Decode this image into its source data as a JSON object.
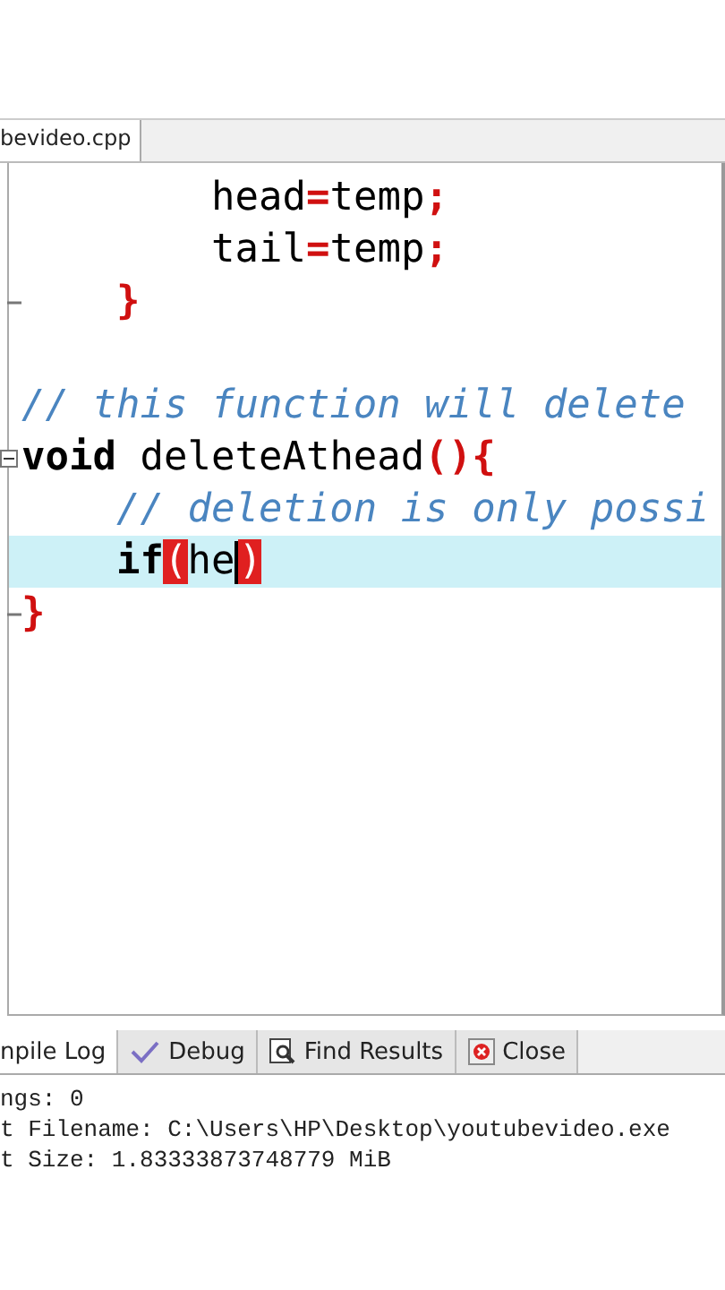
{
  "editor_tabs": [
    {
      "label": "bevideo.cpp",
      "selected": true
    }
  ],
  "code_lines": [
    {
      "kind": "plain",
      "current": false,
      "tokens": [
        {
          "kind": "text",
          "text": "        head"
        },
        {
          "kind": "op",
          "text": "="
        },
        {
          "kind": "text",
          "text": "temp"
        },
        {
          "kind": "op",
          "text": ";"
        }
      ]
    },
    {
      "kind": "plain",
      "current": false,
      "tokens": [
        {
          "kind": "text",
          "text": "        tail"
        },
        {
          "kind": "op",
          "text": "="
        },
        {
          "kind": "text",
          "text": "temp"
        },
        {
          "kind": "op",
          "text": ";"
        }
      ]
    },
    {
      "kind": "foldend",
      "current": false,
      "tokens": [
        {
          "kind": "op",
          "text": "    }"
        }
      ]
    },
    {
      "kind": "blank",
      "current": false
    },
    {
      "kind": "plain",
      "current": false,
      "tokens": [
        {
          "kind": "comment",
          "text": "// this function will delete"
        }
      ]
    },
    {
      "kind": "foldstart",
      "current": false,
      "tokens": [
        {
          "kind": "keyword",
          "text": "void"
        },
        {
          "kind": "text",
          "text": " deleteAthead"
        },
        {
          "kind": "op",
          "text": "(){"
        }
      ]
    },
    {
      "kind": "plain",
      "current": false,
      "tokens": [
        {
          "kind": "comment",
          "text": "    // deletion is only possi"
        }
      ]
    },
    {
      "kind": "plain",
      "current": true,
      "tokens": [
        {
          "kind": "keyword",
          "text": "    if"
        },
        {
          "kind": "match",
          "text": "("
        },
        {
          "kind": "text",
          "text": "he"
        },
        {
          "kind": "caret"
        },
        {
          "kind": "match",
          "text": ")"
        }
      ]
    },
    {
      "kind": "foldend",
      "current": false,
      "tokens": [
        {
          "kind": "op",
          "text": "}"
        }
      ]
    }
  ],
  "panel_tabs": [
    {
      "kind": "log",
      "label": "npile Log",
      "selected": true
    },
    {
      "kind": "debug",
      "label": "Debug",
      "selected": false
    },
    {
      "kind": "find",
      "label": "Find Results",
      "selected": false
    },
    {
      "kind": "close",
      "label": "Close",
      "selected": false
    }
  ],
  "log_lines": [
    "ngs: 0",
    "t Filename: C:\\Users\\HP\\Desktop\\youtubevideo.exe",
    "t Size: 1.83333873748779 MiB"
  ]
}
